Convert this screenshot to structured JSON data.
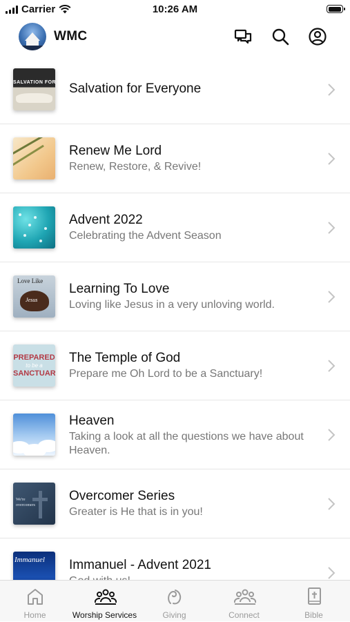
{
  "status_bar": {
    "carrier": "Carrier",
    "time": "10:26 AM"
  },
  "header": {
    "app_name": "WMC"
  },
  "list": [
    {
      "title": "Salvation for Everyone",
      "subtitle": "",
      "thumb_text": "SALVATION FOR ALL"
    },
    {
      "title": "Renew Me Lord",
      "subtitle": "Renew, Restore, & Revive!"
    },
    {
      "title": "Advent 2022",
      "subtitle": "Celebrating the Advent Season"
    },
    {
      "title": "Learning To Love",
      "subtitle": "Loving like Jesus in a very unloving world.",
      "thumb_text": "Love Like",
      "thumb_text2": "Jesus"
    },
    {
      "title": "The Temple of God",
      "subtitle": "Prepare me Oh Lord to be a Sanctuary!",
      "thumb_text": "PREPARED",
      "thumb_text2": "to be a",
      "thumb_text3": "SANCTUARY"
    },
    {
      "title": "Heaven",
      "subtitle": "Taking a look at all the questions we have about Heaven."
    },
    {
      "title": "Overcomer Series",
      "subtitle": "Greater is He that is in you!",
      "thumb_text": "We're",
      "thumb_text2": "overcomers"
    },
    {
      "title": "Immanuel - Advent 2021",
      "subtitle": "God with us!",
      "thumb_text": "Immanuel"
    }
  ],
  "tabs": [
    {
      "label": "Home",
      "icon": "home-icon",
      "active": false
    },
    {
      "label": "Worship Services",
      "icon": "people-icon",
      "active": true
    },
    {
      "label": "Giving",
      "icon": "giving-icon",
      "active": false
    },
    {
      "label": "Connect",
      "icon": "people-icon",
      "active": false
    },
    {
      "label": "Bible",
      "icon": "bible-icon",
      "active": false
    }
  ],
  "colors": {
    "active_tab": "#111111",
    "inactive_tab": "#9a9a9a",
    "subtitle": "#777777"
  }
}
